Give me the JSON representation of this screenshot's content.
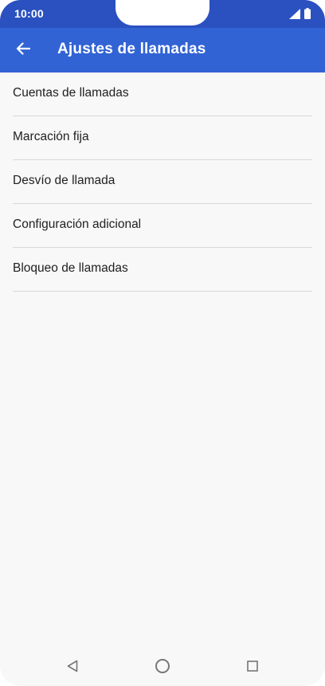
{
  "status_bar": {
    "time": "10:00",
    "icons": [
      "signal-icon",
      "battery-icon"
    ]
  },
  "app_bar": {
    "back_icon": "arrow-left-icon",
    "title": "Ajustes de llamadas"
  },
  "menu": {
    "items": [
      {
        "label": "Cuentas de llamadas"
      },
      {
        "label": "Marcación fija"
      },
      {
        "label": "Desvío de llamada"
      },
      {
        "label": "Configuración adicional"
      },
      {
        "label": "Bloqueo de llamadas"
      }
    ]
  },
  "nav_bar": {
    "icons": [
      "nav-back-icon",
      "nav-home-icon",
      "nav-recents-icon"
    ]
  },
  "colors": {
    "status_bar": "#2b51c0",
    "app_bar": "#3163d4",
    "background": "#f8f8f8",
    "divider": "#d8d8d8",
    "text": "#212121"
  }
}
